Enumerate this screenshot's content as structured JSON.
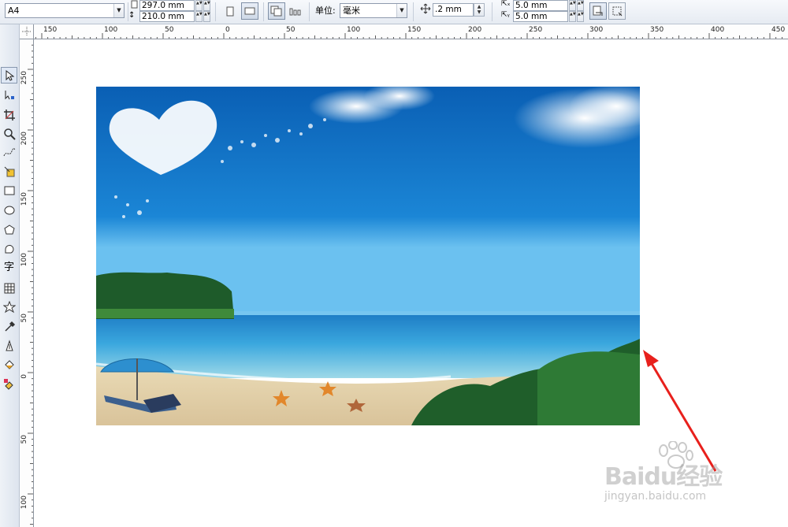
{
  "property_bar": {
    "paper_size": "A4",
    "width": "297.0 mm",
    "height": "210.0 mm",
    "units_label": "单位:",
    "units_value": "毫米",
    "nudge_value": ".2 mm",
    "dup_x": "5.0 mm",
    "dup_y": "5.0 mm"
  },
  "ruler": {
    "h_labels": [
      "150",
      "100",
      "50",
      "0",
      "50",
      "100",
      "150",
      "200",
      "250",
      "300",
      "350",
      "400",
      "450"
    ],
    "v_labels": [
      "250",
      "200",
      "150",
      "100",
      "50",
      "0",
      "50",
      "100"
    ]
  },
  "toolbox": {
    "tools": [
      "pick-tool-icon",
      "shape-tool-icon",
      "crop-tool-icon",
      "zoom-tool-icon",
      "freehand-tool-icon",
      "smart-fill-tool-icon",
      "rectangle-tool-icon",
      "ellipse-tool-icon",
      "polygon-tool-icon",
      "basic-shapes-tool-icon",
      "text-tool-icon",
      "table-tool-icon",
      "interactive-tool-icon",
      "eyedropper-tool-icon",
      "outline-tool-icon",
      "fill-tool-icon",
      "interactive-fill-tool-icon"
    ],
    "text_tool_glyph": "字"
  },
  "watermark": {
    "brand": "Baidu经验",
    "url": "jingyan.baidu.com"
  },
  "colors": {
    "annotation_arrow": "#e8201c",
    "sky_top": "#0a5fb4",
    "sea": "#2f9fd6",
    "sand": "#e6d6b4"
  }
}
